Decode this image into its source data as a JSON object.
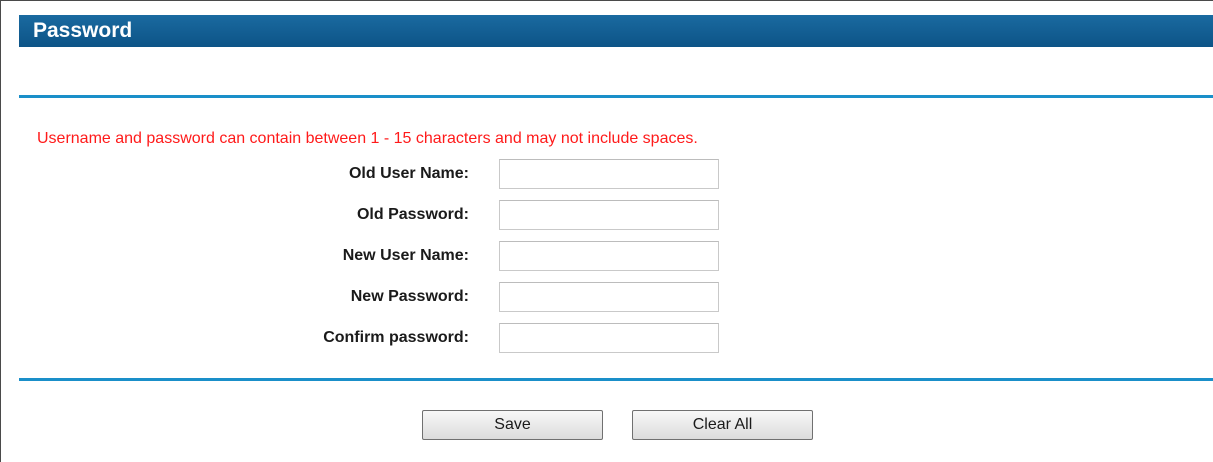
{
  "header": {
    "title": "Password"
  },
  "notice": "Username and password can contain between 1 - 15 characters and may not include spaces.",
  "fields": [
    {
      "label": "Old User Name:",
      "value": "",
      "type": "text"
    },
    {
      "label": "Old Password:",
      "value": "",
      "type": "password"
    },
    {
      "label": "New User Name:",
      "value": "",
      "type": "text"
    },
    {
      "label": "New Password:",
      "value": "",
      "type": "password"
    },
    {
      "label": "Confirm password:",
      "value": "",
      "type": "password"
    }
  ],
  "buttons": {
    "save_label": "Save",
    "clear_label": "Clear All"
  },
  "colors": {
    "header_bg": "#0f5a8f",
    "divider": "#1a8fc9",
    "notice_text": "#ff1a1a"
  }
}
